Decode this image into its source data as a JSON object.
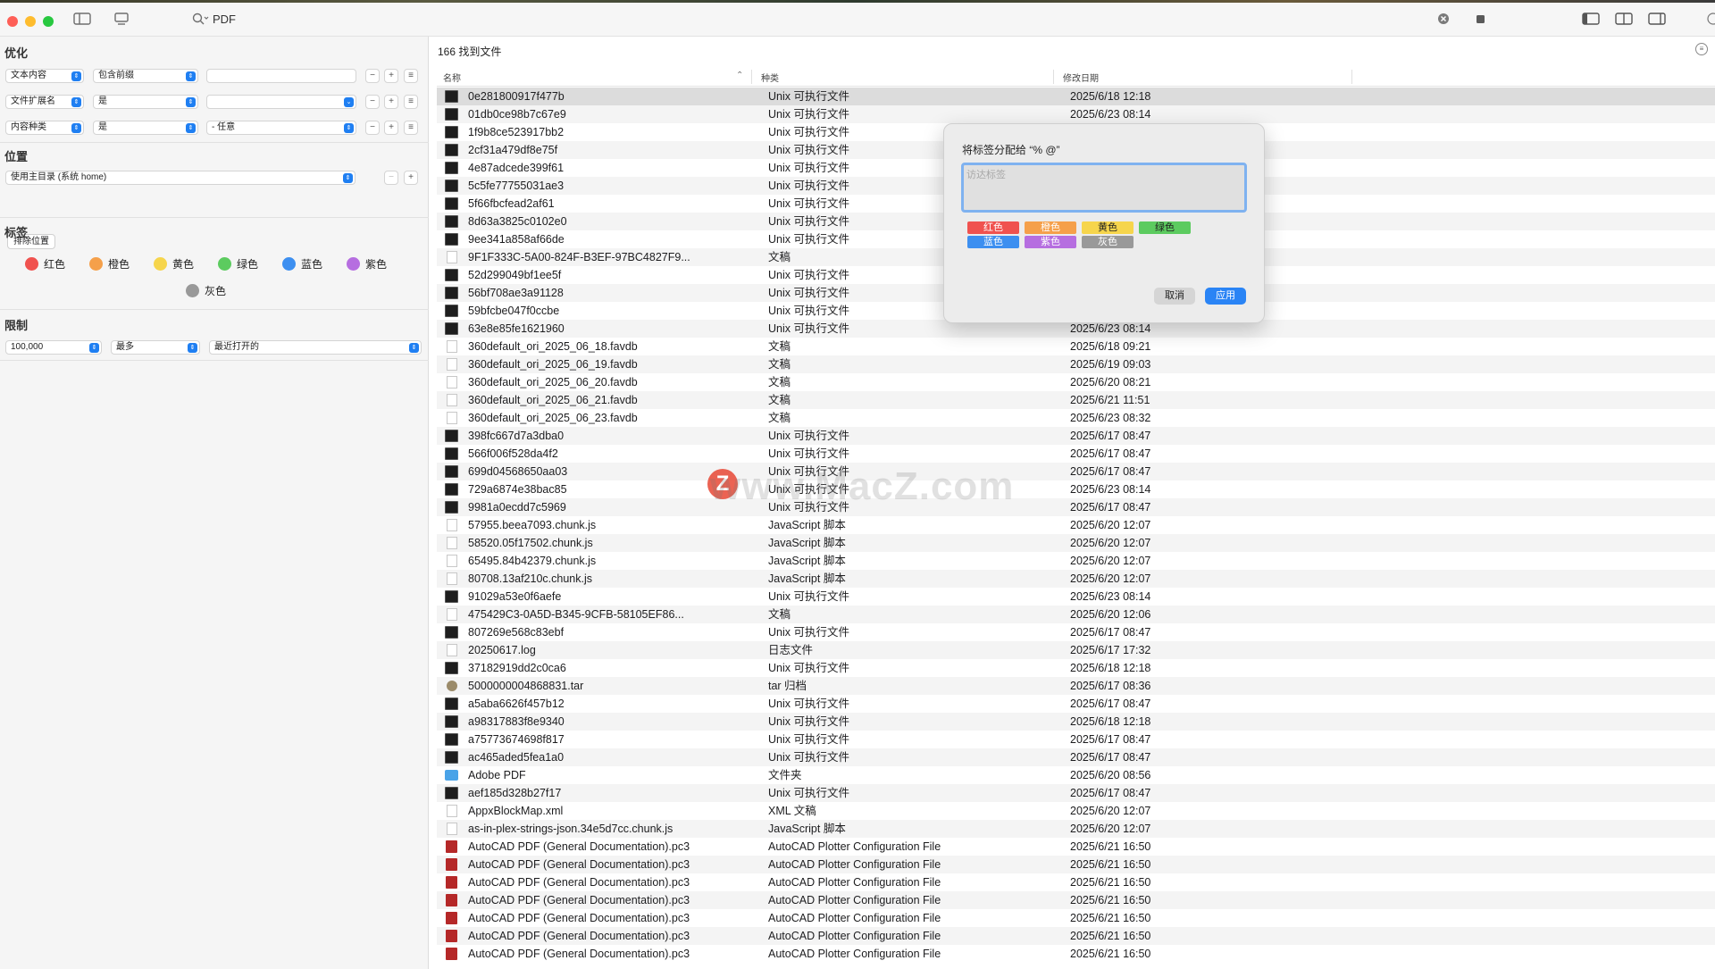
{
  "window": {
    "title": "PDF",
    "result_count": "166 找到文件"
  },
  "sidebar": {
    "optimize_title": "优化",
    "criteria": [
      {
        "attr": "文本内容",
        "op": "包含前缀",
        "value": ""
      },
      {
        "attr": "文件扩展名",
        "op": "是",
        "value": ""
      },
      {
        "attr": "内容种类",
        "op": "是",
        "value": "- 任意"
      }
    ],
    "location_title": "位置",
    "location_value": "使用主目录 (系统 home)",
    "exclude_label": "排除位置",
    "tags_title": "标签",
    "tags": [
      {
        "label": "红色",
        "color": "#f0524f"
      },
      {
        "label": "橙色",
        "color": "#f5a04a"
      },
      {
        "label": "黄色",
        "color": "#f6d54c"
      },
      {
        "label": "绿色",
        "color": "#5ccb5f"
      },
      {
        "label": "蓝色",
        "color": "#3d8ff0"
      },
      {
        "label": "紫色",
        "color": "#b66ee0"
      },
      {
        "label": "灰色",
        "color": "#999999"
      }
    ],
    "limit_title": "限制",
    "limit_value": "100,000",
    "limit_mode": "最多",
    "limit_sort": "最近打开的"
  },
  "table": {
    "headers": {
      "name": "名称",
      "kind": "种类",
      "date": "修改日期"
    },
    "rows": [
      {
        "icon": "exec",
        "name": "0e281800917f477b",
        "kind": "Unix 可执行文件",
        "date": "2025/6/18 12:18"
      },
      {
        "icon": "exec",
        "name": "01db0ce98b7c67e9",
        "kind": "Unix 可执行文件",
        "date": "2025/6/23 08:14"
      },
      {
        "icon": "exec",
        "name": "1f9b8ce523917bb2",
        "kind": "Unix 可执行文件",
        "date": ""
      },
      {
        "icon": "exec",
        "name": "2cf31a479df8e75f",
        "kind": "Unix 可执行文件",
        "date": ""
      },
      {
        "icon": "exec",
        "name": "4e87adcede399f61",
        "kind": "Unix 可执行文件",
        "date": ""
      },
      {
        "icon": "exec",
        "name": "5c5fe77755031ae3",
        "kind": "Unix 可执行文件",
        "date": ""
      },
      {
        "icon": "exec",
        "name": "5f66fbcfead2af61",
        "kind": "Unix 可执行文件",
        "date": ""
      },
      {
        "icon": "exec",
        "name": "8d63a3825c0102e0",
        "kind": "Unix 可执行文件",
        "date": ""
      },
      {
        "icon": "exec",
        "name": "9ee341a858af66de",
        "kind": "Unix 可执行文件",
        "date": ""
      },
      {
        "icon": "doc",
        "name": "9F1F333C-5A00-824F-B3EF-97BC4827F9...",
        "kind": "文稿",
        "date": ""
      },
      {
        "icon": "exec",
        "name": "52d299049bf1ee5f",
        "kind": "Unix 可执行文件",
        "date": ""
      },
      {
        "icon": "exec",
        "name": "56bf708ae3a91128",
        "kind": "Unix 可执行文件",
        "date": ""
      },
      {
        "icon": "exec",
        "name": "59bfcbe047f0ccbe",
        "kind": "Unix 可执行文件",
        "date": ""
      },
      {
        "icon": "exec",
        "name": "63e8e85fe1621960",
        "kind": "Unix 可执行文件",
        "date": "2025/6/23 08:14"
      },
      {
        "icon": "doc",
        "name": "360default_ori_2025_06_18.favdb",
        "kind": "文稿",
        "date": "2025/6/18 09:21"
      },
      {
        "icon": "doc",
        "name": "360default_ori_2025_06_19.favdb",
        "kind": "文稿",
        "date": "2025/6/19 09:03"
      },
      {
        "icon": "doc",
        "name": "360default_ori_2025_06_20.favdb",
        "kind": "文稿",
        "date": "2025/6/20 08:21"
      },
      {
        "icon": "doc",
        "name": "360default_ori_2025_06_21.favdb",
        "kind": "文稿",
        "date": "2025/6/21 11:51"
      },
      {
        "icon": "doc",
        "name": "360default_ori_2025_06_23.favdb",
        "kind": "文稿",
        "date": "2025/6/23 08:32"
      },
      {
        "icon": "exec",
        "name": "398fc667d7a3dba0",
        "kind": "Unix 可执行文件",
        "date": "2025/6/17 08:47"
      },
      {
        "icon": "exec",
        "name": "566f006f528da4f2",
        "kind": "Unix 可执行文件",
        "date": "2025/6/17 08:47"
      },
      {
        "icon": "exec",
        "name": "699d04568650aa03",
        "kind": "Unix 可执行文件",
        "date": "2025/6/17 08:47"
      },
      {
        "icon": "exec",
        "name": "729a6874e38bac85",
        "kind": "Unix 可执行文件",
        "date": "2025/6/23 08:14"
      },
      {
        "icon": "exec",
        "name": "9981a0ecdd7c5969",
        "kind": "Unix 可执行文件",
        "date": "2025/6/17 08:47"
      },
      {
        "icon": "doc",
        "name": "57955.beea7093.chunk.js",
        "kind": "JavaScript 脚本",
        "date": "2025/6/20 12:07"
      },
      {
        "icon": "doc",
        "name": "58520.05f17502.chunk.js",
        "kind": "JavaScript 脚本",
        "date": "2025/6/20 12:07"
      },
      {
        "icon": "doc",
        "name": "65495.84b42379.chunk.js",
        "kind": "JavaScript 脚本",
        "date": "2025/6/20 12:07"
      },
      {
        "icon": "doc",
        "name": "80708.13af210c.chunk.js",
        "kind": "JavaScript 脚本",
        "date": "2025/6/20 12:07"
      },
      {
        "icon": "exec",
        "name": "91029a53e0f6aefe",
        "kind": "Unix 可执行文件",
        "date": "2025/6/23 08:14"
      },
      {
        "icon": "doc",
        "name": "475429C3-0A5D-B345-9CFB-58105EF86...",
        "kind": "文稿",
        "date": "2025/6/20 12:06"
      },
      {
        "icon": "exec",
        "name": "807269e568c83ebf",
        "kind": "Unix 可执行文件",
        "date": "2025/6/17 08:47"
      },
      {
        "icon": "doc",
        "name": "20250617.log",
        "kind": "日志文件",
        "date": "2025/6/17 17:32"
      },
      {
        "icon": "exec",
        "name": "37182919dd2c0ca6",
        "kind": "Unix 可执行文件",
        "date": "2025/6/18 12:18"
      },
      {
        "icon": "tar",
        "name": "5000000004868831.tar",
        "kind": "tar 归档",
        "date": "2025/6/17 08:36"
      },
      {
        "icon": "exec",
        "name": "a5aba6626f457b12",
        "kind": "Unix 可执行文件",
        "date": "2025/6/17 08:47"
      },
      {
        "icon": "exec",
        "name": "a98317883f8e9340",
        "kind": "Unix 可执行文件",
        "date": "2025/6/18 12:18"
      },
      {
        "icon": "exec",
        "name": "a75773674698f817",
        "kind": "Unix 可执行文件",
        "date": "2025/6/17 08:47"
      },
      {
        "icon": "exec",
        "name": "ac465aded5fea1a0",
        "kind": "Unix 可执行文件",
        "date": "2025/6/17 08:47"
      },
      {
        "icon": "folder",
        "name": "Adobe PDF",
        "kind": "文件夹",
        "date": "2025/6/20 08:56"
      },
      {
        "icon": "exec",
        "name": "aef185d328b27f17",
        "kind": "Unix 可执行文件",
        "date": "2025/6/17 08:47"
      },
      {
        "icon": "doc",
        "name": "AppxBlockMap.xml",
        "kind": "XML 文稿",
        "date": "2025/6/20 12:07"
      },
      {
        "icon": "doc",
        "name": "as-in-plex-strings-json.34e5d7cc.chunk.js",
        "kind": "JavaScript 脚本",
        "date": "2025/6/20 12:07"
      },
      {
        "icon": "pc3",
        "name": "AutoCAD PDF (General Documentation).pc3",
        "kind": "AutoCAD Plotter Configuration File",
        "date": "2025/6/21 16:50"
      },
      {
        "icon": "pc3",
        "name": "AutoCAD PDF (General Documentation).pc3",
        "kind": "AutoCAD Plotter Configuration File",
        "date": "2025/6/21 16:50"
      },
      {
        "icon": "pc3",
        "name": "AutoCAD PDF (General Documentation).pc3",
        "kind": "AutoCAD Plotter Configuration File",
        "date": "2025/6/21 16:50"
      },
      {
        "icon": "pc3",
        "name": "AutoCAD PDF (General Documentation).pc3",
        "kind": "AutoCAD Plotter Configuration File",
        "date": "2025/6/21 16:50"
      },
      {
        "icon": "pc3",
        "name": "AutoCAD PDF (General Documentation).pc3",
        "kind": "AutoCAD Plotter Configuration File",
        "date": "2025/6/21 16:50"
      },
      {
        "icon": "pc3",
        "name": "AutoCAD PDF (General Documentation).pc3",
        "kind": "AutoCAD Plotter Configuration File",
        "date": "2025/6/21 16:50"
      },
      {
        "icon": "pc3",
        "name": "AutoCAD PDF (General Documentation).pc3",
        "kind": "AutoCAD Plotter Configuration File",
        "date": "2025/6/21 16:50"
      }
    ]
  },
  "dialog": {
    "title": "将标签分配给 “% @”",
    "placeholder": "访达标签",
    "chips": [
      {
        "label": "红色",
        "color": "#f0524f"
      },
      {
        "label": "橙色",
        "color": "#f5a04a"
      },
      {
        "label": "黄色",
        "color": "#f6d54c",
        "text_color": "#222222"
      },
      {
        "label": "绿色",
        "color": "#5ccb5f",
        "text_color": "#222222"
      },
      {
        "label": "蓝色",
        "color": "#3d8ff0"
      },
      {
        "label": "紫色",
        "color": "#b66ee0"
      },
      {
        "label": "灰色",
        "color": "#999999"
      }
    ],
    "cancel": "取消",
    "apply": "应用"
  },
  "watermark": "www.MacZ.com"
}
